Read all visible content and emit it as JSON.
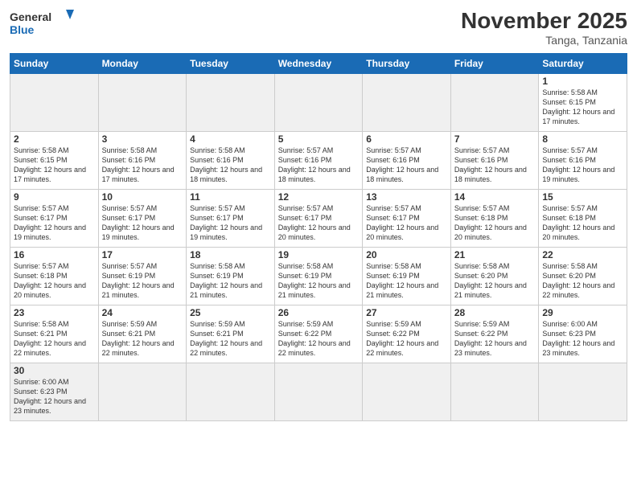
{
  "logo": {
    "text_general": "General",
    "text_blue": "Blue"
  },
  "title": "November 2025",
  "location": "Tanga, Tanzania",
  "days_of_week": [
    "Sunday",
    "Monday",
    "Tuesday",
    "Wednesday",
    "Thursday",
    "Friday",
    "Saturday"
  ],
  "weeks": [
    [
      {
        "day": "",
        "info": ""
      },
      {
        "day": "",
        "info": ""
      },
      {
        "day": "",
        "info": ""
      },
      {
        "day": "",
        "info": ""
      },
      {
        "day": "",
        "info": ""
      },
      {
        "day": "",
        "info": ""
      },
      {
        "day": "1",
        "info": "Sunrise: 5:58 AM\nSunset: 6:15 PM\nDaylight: 12 hours and 17 minutes."
      }
    ],
    [
      {
        "day": "2",
        "info": "Sunrise: 5:58 AM\nSunset: 6:15 PM\nDaylight: 12 hours and 17 minutes."
      },
      {
        "day": "3",
        "info": "Sunrise: 5:58 AM\nSunset: 6:16 PM\nDaylight: 12 hours and 17 minutes."
      },
      {
        "day": "4",
        "info": "Sunrise: 5:58 AM\nSunset: 6:16 PM\nDaylight: 12 hours and 18 minutes."
      },
      {
        "day": "5",
        "info": "Sunrise: 5:57 AM\nSunset: 6:16 PM\nDaylight: 12 hours and 18 minutes."
      },
      {
        "day": "6",
        "info": "Sunrise: 5:57 AM\nSunset: 6:16 PM\nDaylight: 12 hours and 18 minutes."
      },
      {
        "day": "7",
        "info": "Sunrise: 5:57 AM\nSunset: 6:16 PM\nDaylight: 12 hours and 18 minutes."
      },
      {
        "day": "8",
        "info": "Sunrise: 5:57 AM\nSunset: 6:16 PM\nDaylight: 12 hours and 19 minutes."
      }
    ],
    [
      {
        "day": "9",
        "info": "Sunrise: 5:57 AM\nSunset: 6:17 PM\nDaylight: 12 hours and 19 minutes."
      },
      {
        "day": "10",
        "info": "Sunrise: 5:57 AM\nSunset: 6:17 PM\nDaylight: 12 hours and 19 minutes."
      },
      {
        "day": "11",
        "info": "Sunrise: 5:57 AM\nSunset: 6:17 PM\nDaylight: 12 hours and 19 minutes."
      },
      {
        "day": "12",
        "info": "Sunrise: 5:57 AM\nSunset: 6:17 PM\nDaylight: 12 hours and 20 minutes."
      },
      {
        "day": "13",
        "info": "Sunrise: 5:57 AM\nSunset: 6:17 PM\nDaylight: 12 hours and 20 minutes."
      },
      {
        "day": "14",
        "info": "Sunrise: 5:57 AM\nSunset: 6:18 PM\nDaylight: 12 hours and 20 minutes."
      },
      {
        "day": "15",
        "info": "Sunrise: 5:57 AM\nSunset: 6:18 PM\nDaylight: 12 hours and 20 minutes."
      }
    ],
    [
      {
        "day": "16",
        "info": "Sunrise: 5:57 AM\nSunset: 6:18 PM\nDaylight: 12 hours and 20 minutes."
      },
      {
        "day": "17",
        "info": "Sunrise: 5:57 AM\nSunset: 6:19 PM\nDaylight: 12 hours and 21 minutes."
      },
      {
        "day": "18",
        "info": "Sunrise: 5:58 AM\nSunset: 6:19 PM\nDaylight: 12 hours and 21 minutes."
      },
      {
        "day": "19",
        "info": "Sunrise: 5:58 AM\nSunset: 6:19 PM\nDaylight: 12 hours and 21 minutes."
      },
      {
        "day": "20",
        "info": "Sunrise: 5:58 AM\nSunset: 6:19 PM\nDaylight: 12 hours and 21 minutes."
      },
      {
        "day": "21",
        "info": "Sunrise: 5:58 AM\nSunset: 6:20 PM\nDaylight: 12 hours and 21 minutes."
      },
      {
        "day": "22",
        "info": "Sunrise: 5:58 AM\nSunset: 6:20 PM\nDaylight: 12 hours and 22 minutes."
      }
    ],
    [
      {
        "day": "23",
        "info": "Sunrise: 5:58 AM\nSunset: 6:21 PM\nDaylight: 12 hours and 22 minutes."
      },
      {
        "day": "24",
        "info": "Sunrise: 5:59 AM\nSunset: 6:21 PM\nDaylight: 12 hours and 22 minutes."
      },
      {
        "day": "25",
        "info": "Sunrise: 5:59 AM\nSunset: 6:21 PM\nDaylight: 12 hours and 22 minutes."
      },
      {
        "day": "26",
        "info": "Sunrise: 5:59 AM\nSunset: 6:22 PM\nDaylight: 12 hours and 22 minutes."
      },
      {
        "day": "27",
        "info": "Sunrise: 5:59 AM\nSunset: 6:22 PM\nDaylight: 12 hours and 22 minutes."
      },
      {
        "day": "28",
        "info": "Sunrise: 5:59 AM\nSunset: 6:22 PM\nDaylight: 12 hours and 23 minutes."
      },
      {
        "day": "29",
        "info": "Sunrise: 6:00 AM\nSunset: 6:23 PM\nDaylight: 12 hours and 23 minutes."
      }
    ],
    [
      {
        "day": "30",
        "info": "Sunrise: 6:00 AM\nSunset: 6:23 PM\nDaylight: 12 hours and 23 minutes."
      },
      {
        "day": "",
        "info": ""
      },
      {
        "day": "",
        "info": ""
      },
      {
        "day": "",
        "info": ""
      },
      {
        "day": "",
        "info": ""
      },
      {
        "day": "",
        "info": ""
      },
      {
        "day": "",
        "info": ""
      }
    ]
  ]
}
